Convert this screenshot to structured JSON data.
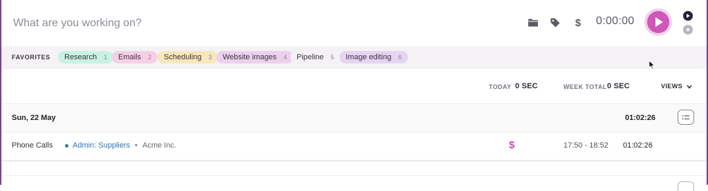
{
  "timer": {
    "placeholder": "What are you working on?",
    "project_icon": "folder-icon",
    "tag_icon": "tag-icon",
    "billable_symbol": "$",
    "elapsed": "0:00:00",
    "start_icon": "play-icon"
  },
  "favorites": {
    "label": "FAVORITES",
    "items": [
      {
        "name": "Research",
        "count": "1",
        "color": "#c8f2e4"
      },
      {
        "name": "Emails",
        "count": "2",
        "color": "#f6cfe6"
      },
      {
        "name": "Scheduling",
        "count": "3",
        "color": "#f8e6bc"
      },
      {
        "name": "Website images",
        "count": "4",
        "color": "#ecd0ee"
      },
      {
        "name": "Pipeline",
        "count": "5",
        "color": "#f4f2f4"
      },
      {
        "name": "Image editing",
        "count": "6",
        "color": "#e6d4f2"
      }
    ]
  },
  "summary": {
    "today_label": "TODAY",
    "today_value": "0 SEC",
    "week_label": "WEEK TOTAL",
    "week_value": "0 SEC",
    "views_label": "VIEWS"
  },
  "day": {
    "date": "Sun, 22 May",
    "total": "01:02:26"
  },
  "entries": [
    {
      "description": "Phone Calls",
      "project": "Admin: Suppliers",
      "separator": "•",
      "client": "Acme Inc.",
      "billable_symbol": "$",
      "time_range": "17:50 - 18:52",
      "duration": "01:02:26"
    }
  ]
}
